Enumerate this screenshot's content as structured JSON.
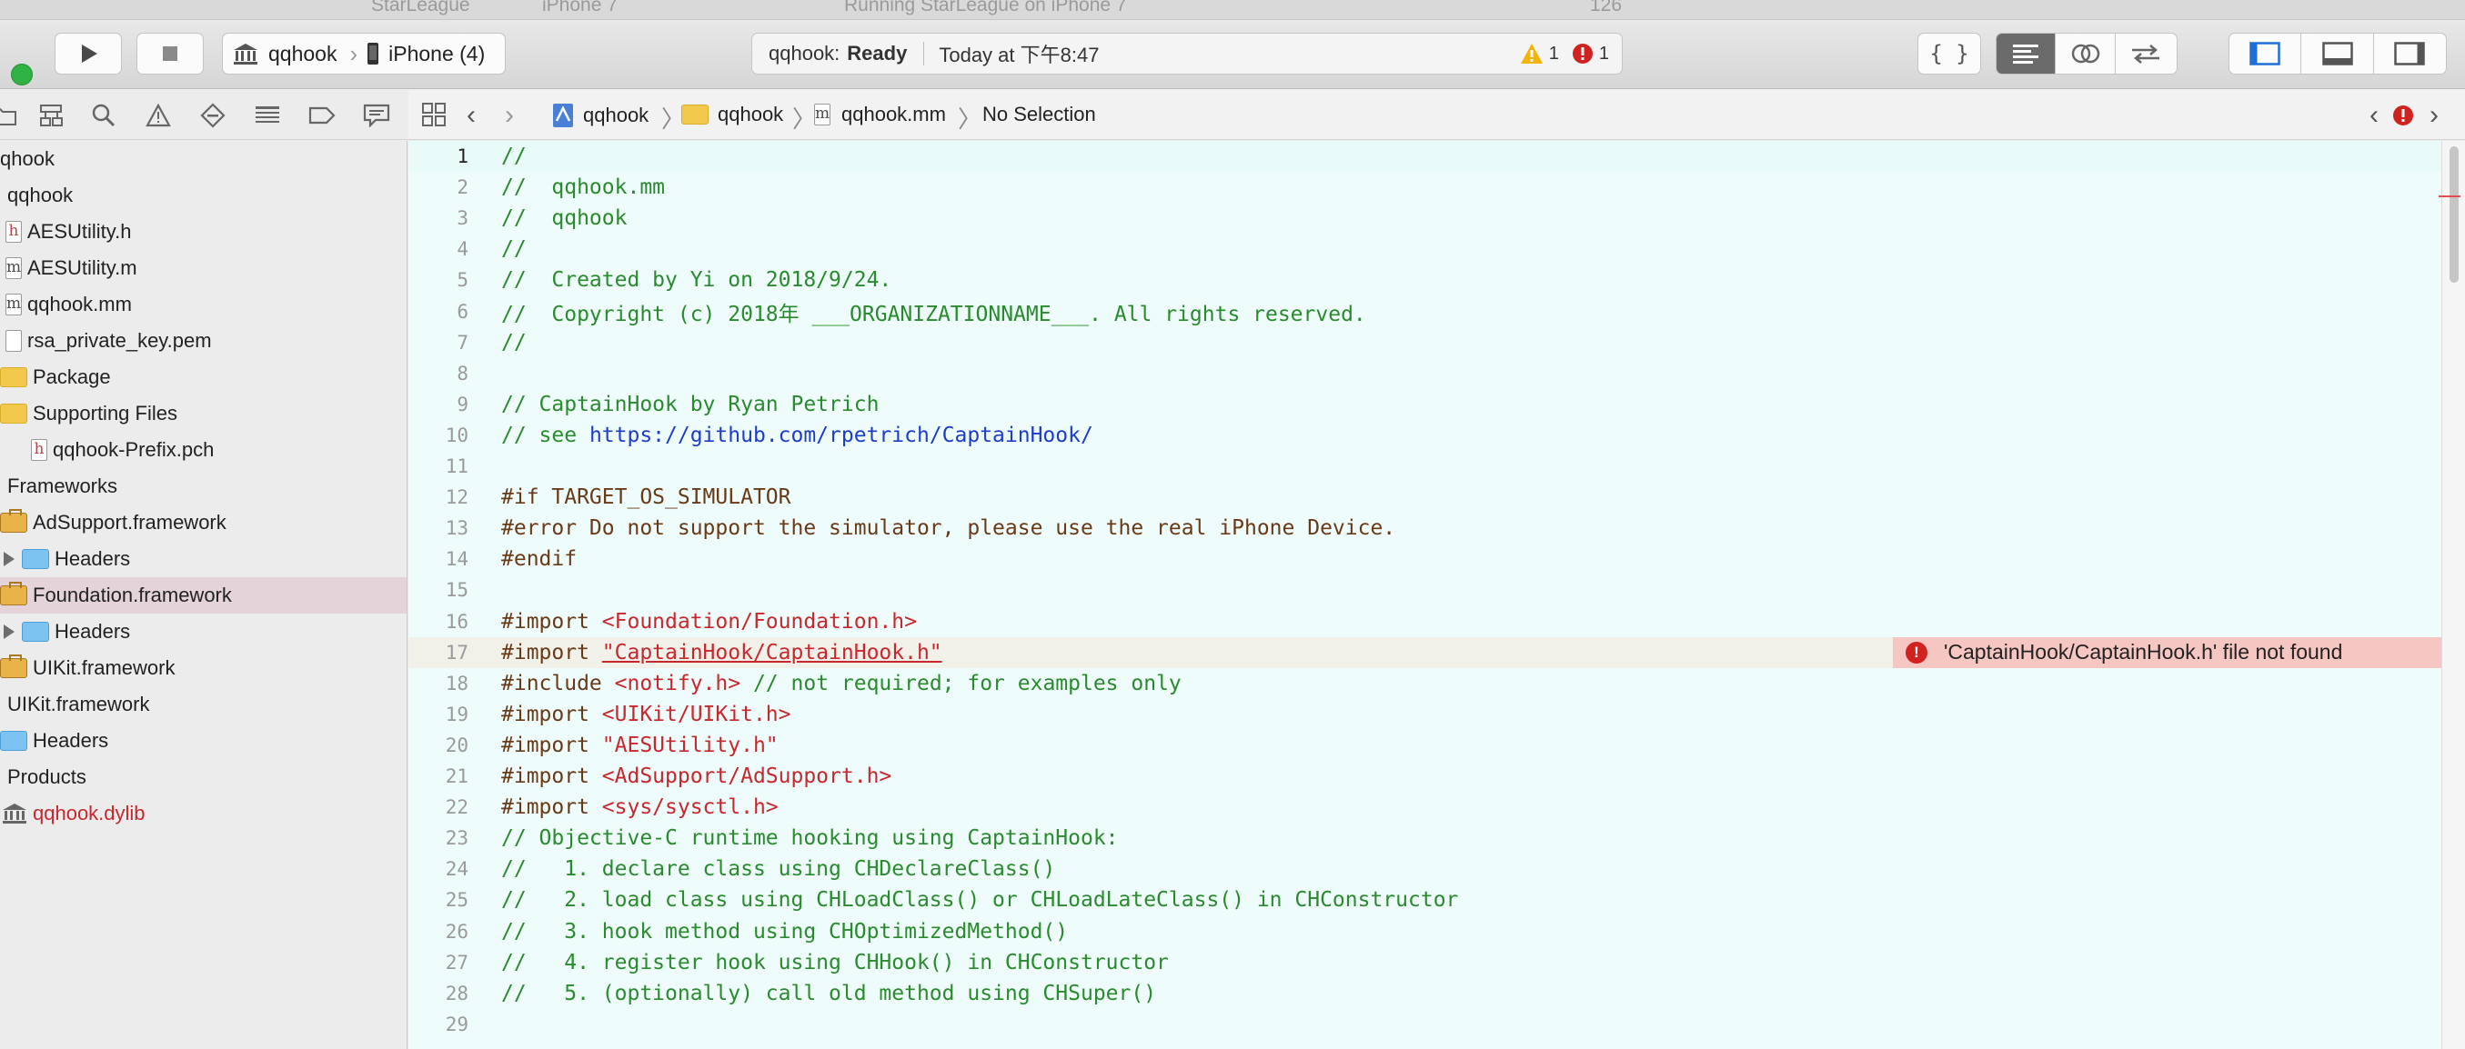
{
  "ghost_window": {
    "scheme": "StarLeague",
    "device": "iPhone 7",
    "status": "Running StarLeague on iPhone 7",
    "warning_count": "126"
  },
  "toolbar": {
    "scheme_target": "qqhook",
    "scheme_device": "iPhone (4)",
    "activity_project": "qqhook:",
    "activity_state": "Ready",
    "activity_time": "Today at 下午8:47",
    "warning_count": "1",
    "error_count": "1",
    "colors": {
      "run_green": "#2fb344",
      "warning": "#f2b40c",
      "error": "#d0221f"
    }
  },
  "navigator_tabs": [
    "folder-icon",
    "source-control-icon",
    "search-icon",
    "warning-icon",
    "breakpoint-icon",
    "list-icon",
    "tag-icon",
    "comment-icon"
  ],
  "navigator": {
    "items": [
      {
        "label": "qhook",
        "kind": "project"
      },
      {
        "label": "qqhook",
        "kind": "group"
      },
      {
        "label": "AESUtility.h",
        "kind": "h"
      },
      {
        "label": "AESUtility.m",
        "kind": "m"
      },
      {
        "label": "qqhook.mm",
        "kind": "m"
      },
      {
        "label": "rsa_private_key.pem",
        "kind": "file"
      },
      {
        "label": "Package",
        "kind": "folder"
      },
      {
        "label": "Supporting Files",
        "kind": "folder"
      },
      {
        "label": "qqhook-Prefix.pch",
        "kind": "h"
      },
      {
        "label": "Frameworks",
        "kind": "group"
      },
      {
        "label": "AdSupport.framework",
        "kind": "framework"
      },
      {
        "label": "Headers",
        "kind": "blue-folder"
      },
      {
        "label": "Foundation.framework",
        "kind": "framework",
        "selected": true
      },
      {
        "label": "Headers",
        "kind": "blue-folder"
      },
      {
        "label": "UIKit.framework",
        "kind": "framework"
      },
      {
        "label": "UIKit.framework",
        "kind": "group"
      },
      {
        "label": "Headers",
        "kind": "blue-folder"
      },
      {
        "label": "Products",
        "kind": "group"
      },
      {
        "label": "qqhook.dylib",
        "kind": "product",
        "color": "#c8272d"
      }
    ]
  },
  "jumpbar": {
    "crumbs": [
      "qqhook",
      "qqhook",
      "qqhook.mm",
      "No Selection"
    ]
  },
  "editor": {
    "current_line": 1,
    "error_line": 17,
    "error_message": "'CaptainHook/CaptainHook.h' file not found",
    "lines": [
      {
        "n": "1",
        "text": "//",
        "style": "comment"
      },
      {
        "n": "2",
        "text": "//  qqhook.mm",
        "style": "comment"
      },
      {
        "n": "3",
        "text": "//  qqhook",
        "style": "comment"
      },
      {
        "n": "4",
        "text": "//",
        "style": "comment"
      },
      {
        "n": "5",
        "text": "//  Created by Yi on 2018/9/24.",
        "style": "comment"
      },
      {
        "n": "6",
        "text": "//  Copyright (c) 2018年 ___ORGANIZATIONNAME___. All rights reserved.",
        "style": "comment"
      },
      {
        "n": "7",
        "text": "//",
        "style": "comment"
      },
      {
        "n": "8",
        "text": "",
        "style": "plain"
      },
      {
        "n": "9",
        "text": "// CaptainHook by Ryan Petrich",
        "style": "comment"
      },
      {
        "n": "10",
        "text": "// see ",
        "link": "https://github.com/rpetrich/CaptainHook/",
        "style": "comment"
      },
      {
        "n": "11",
        "text": "",
        "style": "plain"
      },
      {
        "n": "12",
        "text": "#if TARGET_OS_SIMULATOR",
        "style": "pre"
      },
      {
        "n": "13",
        "text": "#error Do not support the simulator, please use the real iPhone Device.",
        "style": "pre"
      },
      {
        "n": "14",
        "text": "#endif",
        "style": "pre"
      },
      {
        "n": "15",
        "text": "",
        "style": "plain"
      },
      {
        "n": "16",
        "text": "#import ",
        "str": "<Foundation/Foundation.h>",
        "style": "pre"
      },
      {
        "n": "17",
        "text": "#import ",
        "str": "\"CaptainHook/CaptainHook.h\"",
        "style": "pre",
        "underline": true
      },
      {
        "n": "18",
        "text": "#include ",
        "str": "<notify.h>",
        "tail": " // not required; for examples only",
        "style": "pre"
      },
      {
        "n": "19",
        "text": "#import ",
        "str": "<UIKit/UIKit.h>",
        "style": "pre"
      },
      {
        "n": "20",
        "text": "#import ",
        "str": "\"AESUtility.h\"",
        "style": "pre"
      },
      {
        "n": "21",
        "text": "#import ",
        "str": "<AdSupport/AdSupport.h>",
        "style": "pre"
      },
      {
        "n": "22",
        "text": "#import ",
        "str": "<sys/sysctl.h>",
        "style": "pre"
      },
      {
        "n": "23",
        "text": "// Objective-C runtime hooking using CaptainHook:",
        "style": "comment"
      },
      {
        "n": "24",
        "text": "//   1. declare class using CHDeclareClass()",
        "style": "comment"
      },
      {
        "n": "25",
        "text": "//   2. load class using CHLoadClass() or CHLoadLateClass() in CHConstructor",
        "style": "comment"
      },
      {
        "n": "26",
        "text": "//   3. hook method using CHOptimizedMethod()",
        "style": "comment"
      },
      {
        "n": "27",
        "text": "//   4. register hook using CHHook() in CHConstructor",
        "style": "comment"
      },
      {
        "n": "28",
        "text": "//   5. (optionally) call old method using CHSuper()",
        "style": "comment"
      },
      {
        "n": "29",
        "text": "",
        "style": "plain"
      }
    ]
  }
}
